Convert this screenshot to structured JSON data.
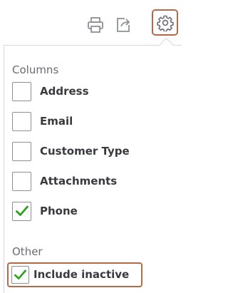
{
  "toolbar": {
    "icons": [
      "printer-icon",
      "export-icon",
      "gear-icon"
    ]
  },
  "columns": {
    "title": "Columns",
    "items": [
      {
        "label": "Address",
        "checked": false
      },
      {
        "label": "Email",
        "checked": false
      },
      {
        "label": "Customer Type",
        "checked": false
      },
      {
        "label": "Attachments",
        "checked": false
      },
      {
        "label": "Phone",
        "checked": true
      }
    ]
  },
  "other": {
    "title": "Other",
    "items": [
      {
        "label": "Include inactive",
        "checked": true
      }
    ]
  },
  "colors": {
    "check": "#2ca01c",
    "highlight": "#b66a43",
    "icon": "#8d9096"
  }
}
